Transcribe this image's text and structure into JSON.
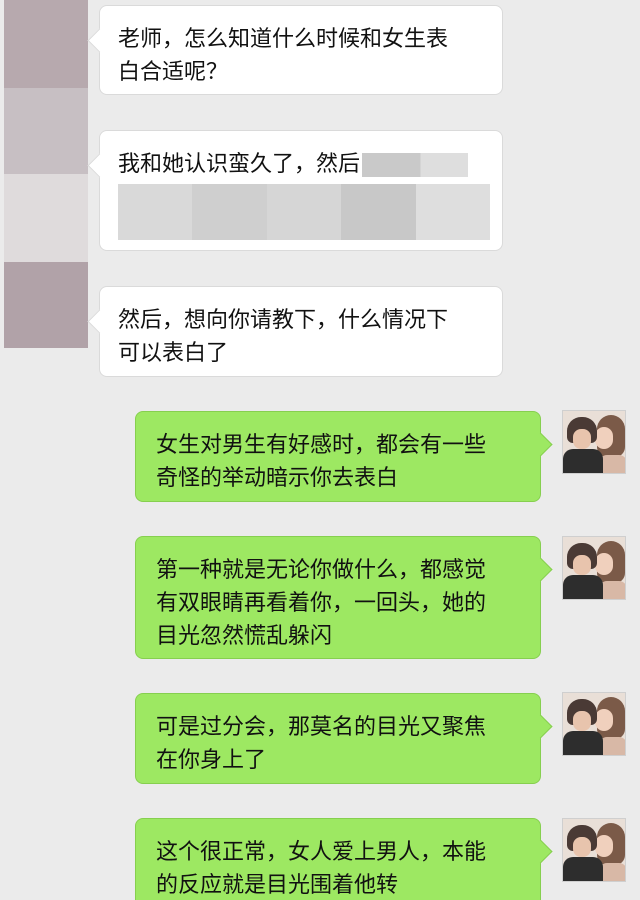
{
  "messages": [
    {
      "side": "in",
      "text": [
        "老师，怎么知道什么时候和女生表",
        "白合适呢？"
      ]
    },
    {
      "side": "in",
      "text": [
        "我和她认识蛮久了，然后"
      ],
      "redacted": true
    },
    {
      "side": "in",
      "text": [
        "然后，想向你请教下，什么情况下",
        "可以表白了"
      ]
    },
    {
      "side": "out",
      "text": [
        "女生对男生有好感时，都会有一些",
        "奇怪的举动暗示你去表白"
      ]
    },
    {
      "side": "out",
      "text": [
        "第一种就是无论你做什么，都感觉",
        "有双眼睛再看着你，一回头，她的",
        "目光忽然慌乱躲闪"
      ]
    },
    {
      "side": "out",
      "text": [
        "可是过分会，那莫名的目光又聚焦",
        "在你身上了"
      ]
    },
    {
      "side": "out",
      "text": [
        "这个很正常，女人爱上男人，本能",
        "的反应就是目光围着他转"
      ]
    }
  ],
  "colors": {
    "background": "#ebebeb",
    "incoming_bubble": "#ffffff",
    "outgoing_bubble": "#9de862"
  },
  "icons": {
    "left_avatar": "blurred-avatar",
    "right_avatar": "couple-photo-avatar"
  }
}
